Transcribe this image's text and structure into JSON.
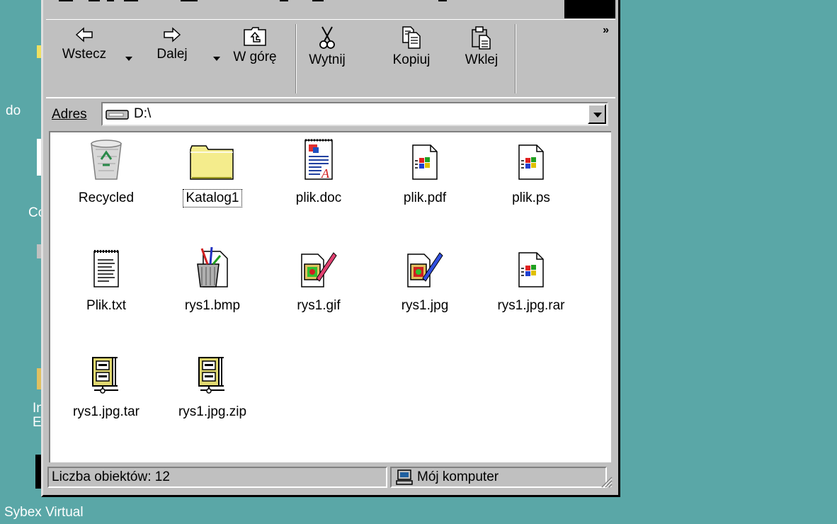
{
  "desktop": {
    "labels": [
      "do",
      "Co",
      "In",
      "E",
      "Sybex Virtual"
    ]
  },
  "toolbar": {
    "back_label": "Wstecz",
    "forward_label": "Dalej",
    "up_label": "W górę",
    "cut_label": "Wytnij",
    "copy_label": "Kopiuj",
    "paste_label": "Wklej",
    "more_label": "»"
  },
  "address": {
    "label": "Adres",
    "value": "D:\\"
  },
  "files": [
    {
      "name": "Recycled",
      "icon": "recycle-bin-icon"
    },
    {
      "name": "Katalog1",
      "icon": "folder-icon"
    },
    {
      "name": "plik.doc",
      "icon": "word-document-icon"
    },
    {
      "name": "plik.pdf",
      "icon": "windows-file-icon"
    },
    {
      "name": "plik.ps",
      "icon": "windows-file-icon"
    },
    {
      "name": "Plik.txt",
      "icon": "text-file-icon"
    },
    {
      "name": "rys1.bmp",
      "icon": "paint-file-icon"
    },
    {
      "name": "rys1.gif",
      "icon": "image-file-icon"
    },
    {
      "name": "rys1.jpg",
      "icon": "image-file-icon"
    },
    {
      "name": "rys1.jpg.rar",
      "icon": "windows-file-icon"
    },
    {
      "name": "rys1.jpg.tar",
      "icon": "archive-icon"
    },
    {
      "name": "rys1.jpg.zip",
      "icon": "archive-icon"
    }
  ],
  "status": {
    "count": "Liczba obiektów: 12",
    "location": "Mój komputer"
  },
  "colors": {
    "desktop": "#5aa7a7",
    "window": "#c0c0c0",
    "folder": "#f4ec8c"
  }
}
